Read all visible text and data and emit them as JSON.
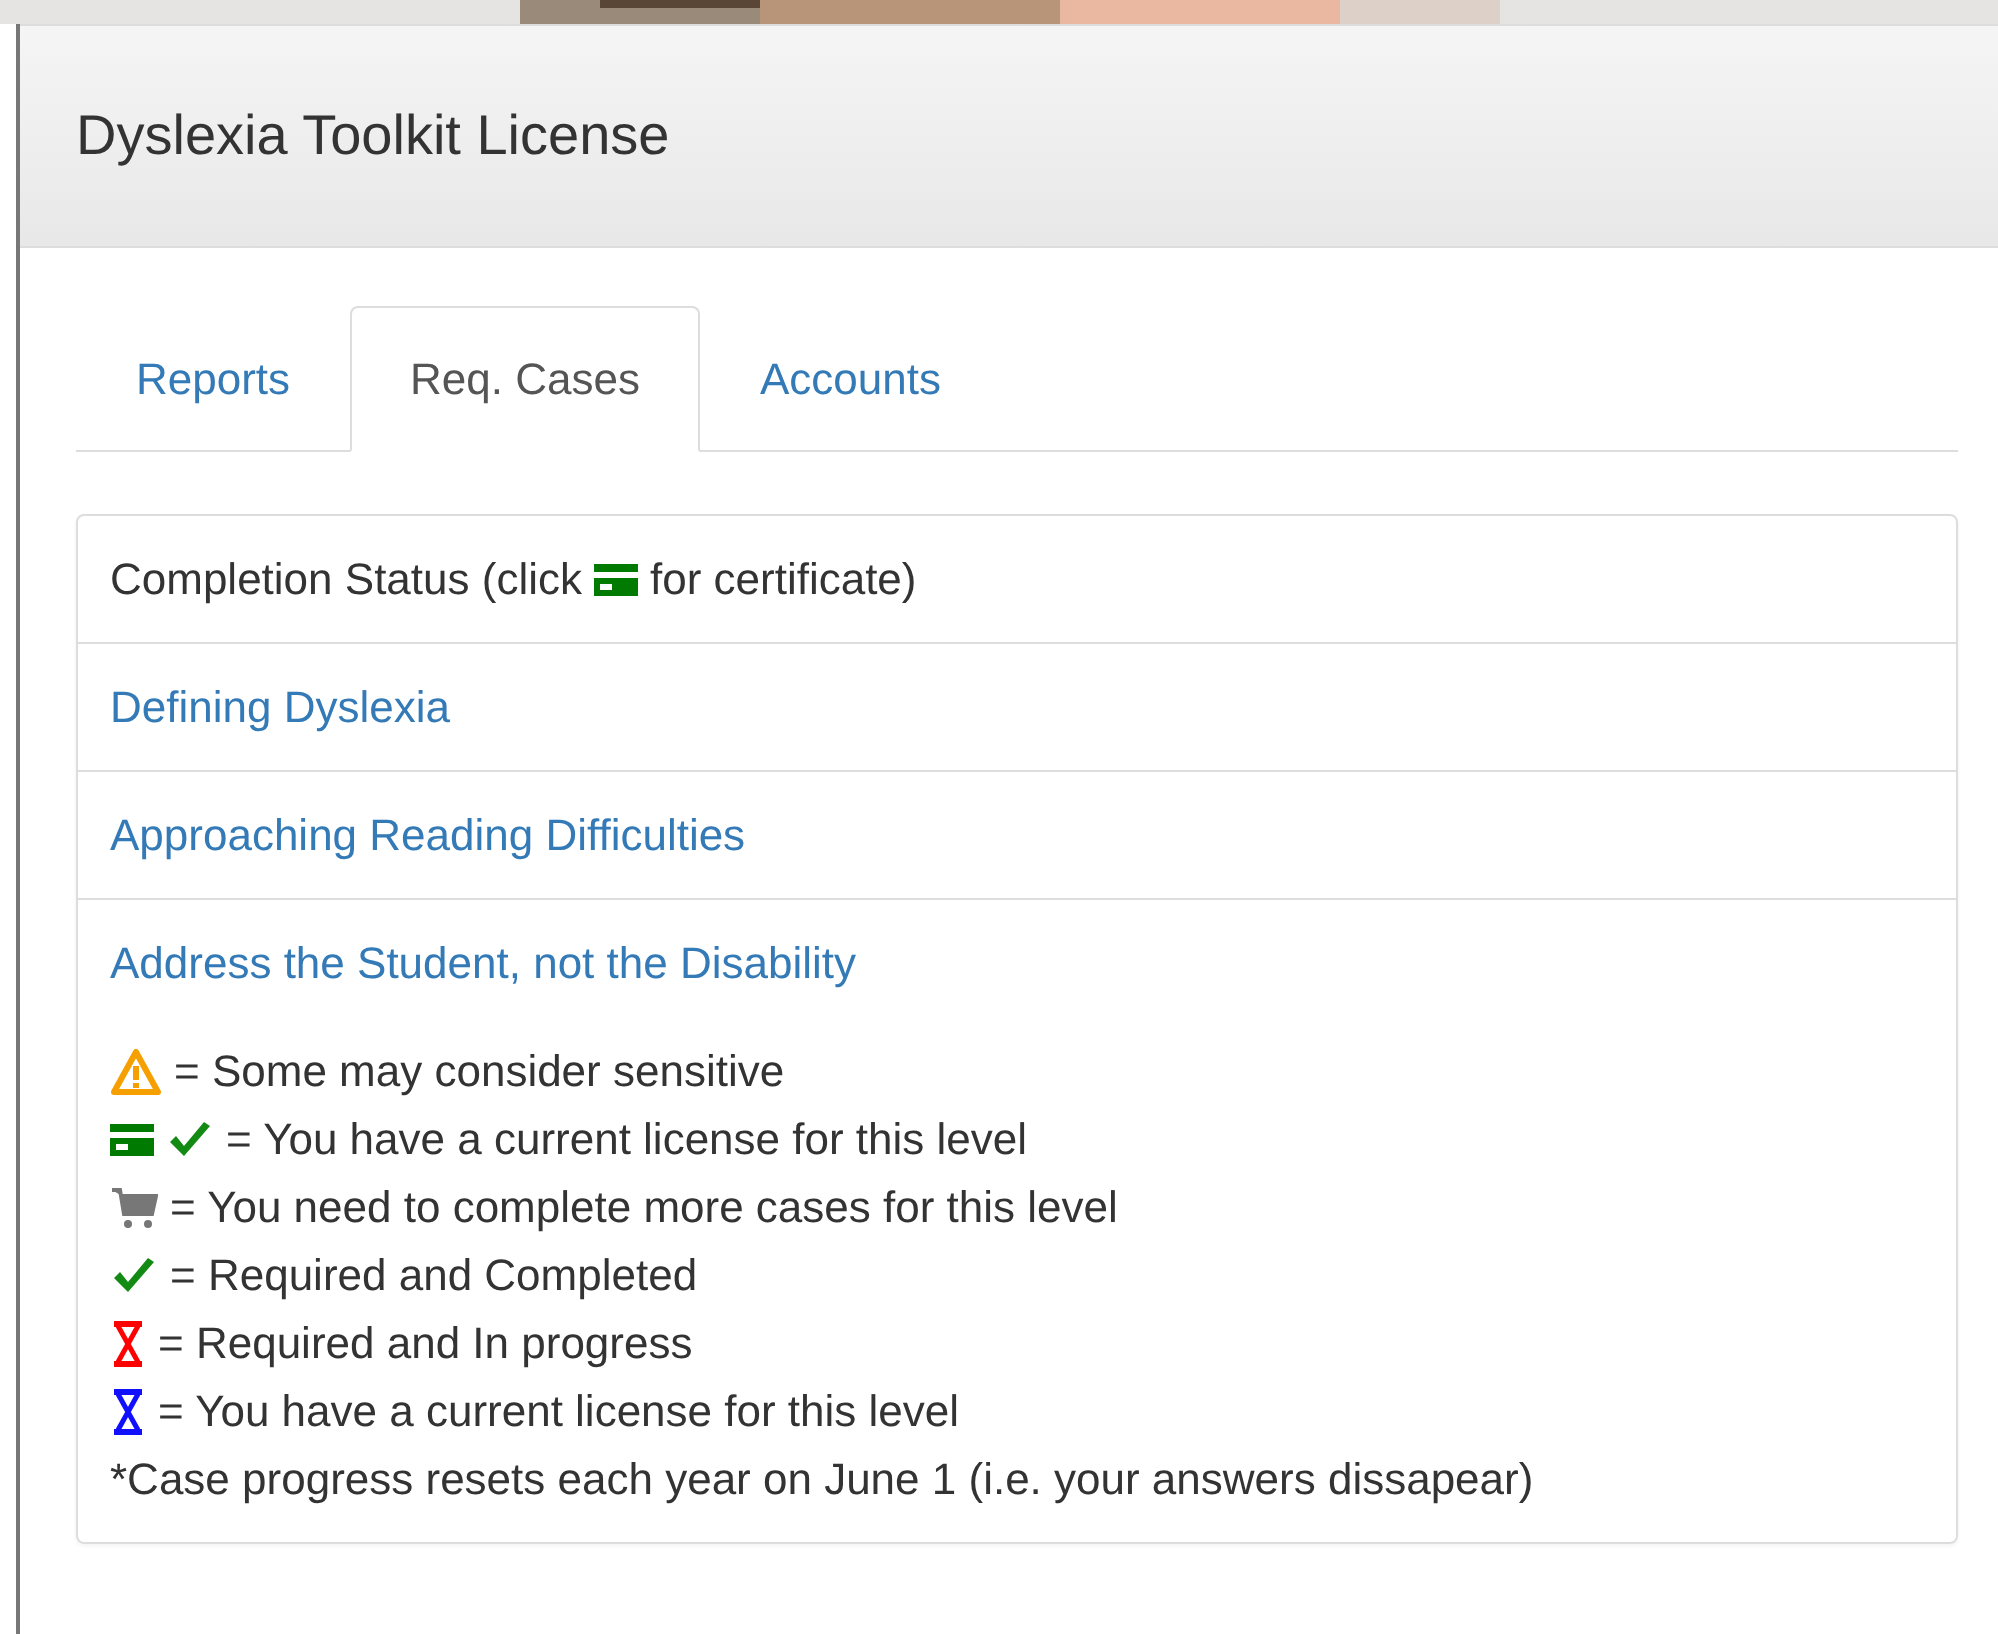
{
  "panel": {
    "title": "Dyslexia Toolkit License"
  },
  "tabs": [
    {
      "label": "Reports",
      "selected": false
    },
    {
      "label": "Req. Cases",
      "selected": true
    },
    {
      "label": "Accounts",
      "selected": false
    }
  ],
  "list": [
    {
      "kind": "status",
      "before": "Completion Status (click",
      "after": "for certificate)"
    },
    {
      "kind": "link",
      "label": "Defining Dyslexia"
    },
    {
      "kind": "link",
      "label": "Approaching Reading Difficulties"
    },
    {
      "kind": "link",
      "label": "Address the Student, not the Disability"
    }
  ],
  "legend": [
    {
      "kind": "warning",
      "text": "= Some may consider sensitive"
    },
    {
      "kind": "licensed",
      "text": "= You have a current license for this level"
    },
    {
      "kind": "cart",
      "text": "= You need to complete more cases for this level"
    },
    {
      "kind": "check",
      "text": "= Required and Completed"
    },
    {
      "kind": "pending",
      "text": "= Required and In progress"
    },
    {
      "kind": "current",
      "text": "= You have a current license for this level"
    },
    {
      "kind": "note",
      "text": "*Case progress resets each year on June 1 (i.e. your answers dissapear)"
    }
  ]
}
